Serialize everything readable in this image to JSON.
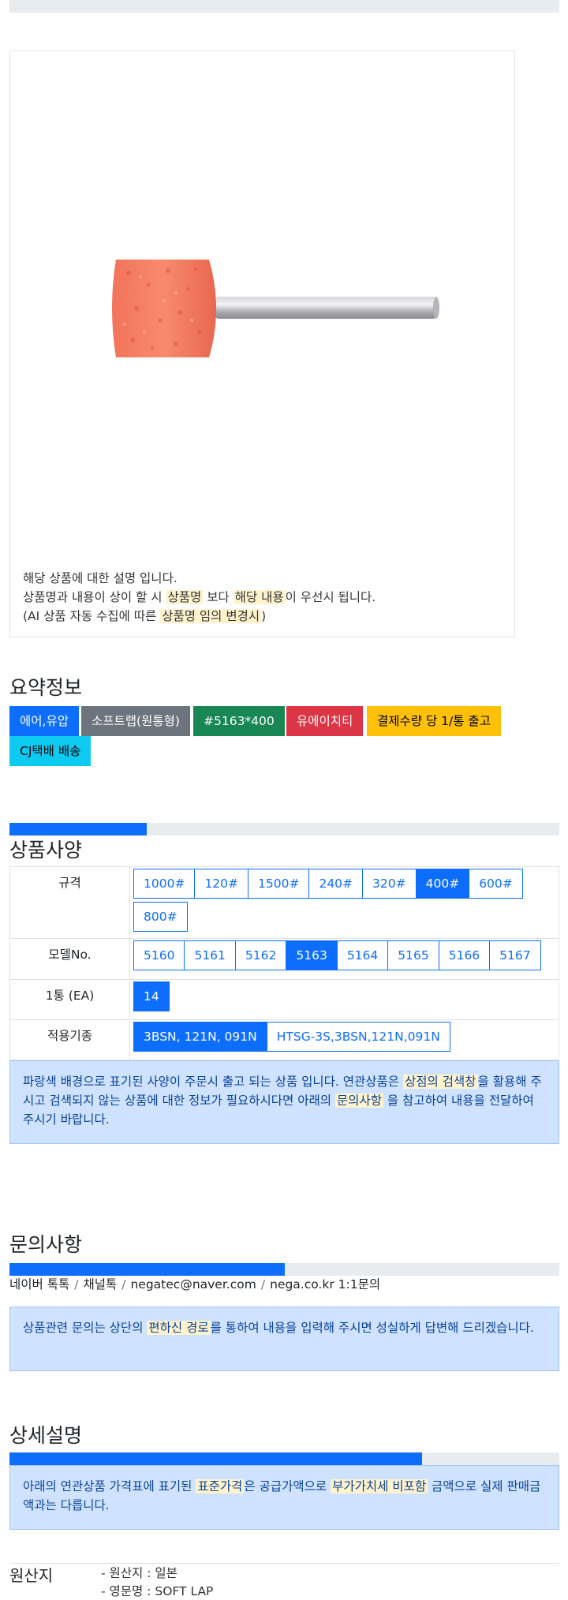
{
  "description": {
    "line1": "해당 상품에 대한 설명 입니다.",
    "line2_a": "상품명과 내용이 상이 할 시 ",
    "line2_hl1": "상품명",
    "line2_b": " 보다 ",
    "line2_hl2": "해당 내용",
    "line2_c": "이 우선시 됩니다.",
    "line3_a": "(AI 상품 자동 수집에 따른 ",
    "line3_hl": "상품명 임의 변경시",
    "line3_b": ")"
  },
  "summary": {
    "title": "요약정보",
    "badges": [
      {
        "label": "에어,유압",
        "color": "#0d6efd",
        "text_color": "#ffffff"
      },
      {
        "label": "소프트랩(원통형)",
        "color": "#6c757d",
        "text_color": "#ffffff"
      },
      {
        "label": "#5163*400",
        "color": "#198754",
        "text_color": "#ffffff"
      },
      {
        "label": "유에이치티",
        "color": "#dc3545",
        "text_color": "#ffffff"
      },
      {
        "label": "결제수량 당 1/통 출고",
        "color": "#ffc107",
        "text_color": "#000000"
      },
      {
        "label": "CJ택배 배송",
        "color": "#0dcaf0",
        "text_color": "#000000"
      }
    ]
  },
  "spec": {
    "title": "상품사양",
    "progress": 0.25,
    "rows": [
      {
        "label": "규격",
        "options": [
          "1000#",
          "120#",
          "1500#",
          "240#",
          "320#",
          "400#",
          "600#",
          "800#"
        ],
        "selected": "400#"
      },
      {
        "label": "모델No.",
        "options": [
          "5160",
          "5161",
          "5162",
          "5163",
          "5164",
          "5165",
          "5166",
          "5167"
        ],
        "selected": "5163"
      },
      {
        "label": "1통 (EA)",
        "options": [
          "14"
        ],
        "selected": "14"
      },
      {
        "label": "적용기종",
        "options": [
          "3BSN, 121N, 091N",
          "HTSG-3S,3BSN,121N,091N"
        ],
        "selected": "3BSN, 121N, 091N"
      }
    ],
    "notice_a": "파랑색 배경으로 표기된 사양이 주문시 출고 되는 상품 입니다. 연관상품은 ",
    "notice_hl1": "상점의 검색창",
    "notice_b": "을 활용해 주시고 검색되지 않는 상품에 대한 정보가 필요하시다면 아래의 ",
    "notice_hl2": "문의사항",
    "notice_c": " 을 참고하여 내용을 전달하여 주시기 바랍니다."
  },
  "inquiry": {
    "title": "문의사항",
    "progress": 0.5,
    "channels": [
      "네이버 톡톡",
      "채널톡",
      "negatec@naver.com",
      "nega.co.kr 1:1문의"
    ],
    "separator": "/",
    "notice_a": "상품관련 문의는 상단의 ",
    "notice_hl": "편하신 경로",
    "notice_b": "를 통하여 내용을 입력해 주시면 성실하게 답변해 드리겠습니다."
  },
  "detail": {
    "title": "상세설명",
    "progress": 0.75,
    "notice_a": "아래의 연관상품 가격표에 표기된 ",
    "notice_hl1": "표준가격",
    "notice_b": "은 공급가액으로 ",
    "notice_hl2": "부가가치세 비포함",
    "notice_c": " 금액으로 실제 판매금액과는 다릅니다."
  },
  "origin": {
    "title": "원산지",
    "items": [
      "- 원산지 : 일본",
      "- 영문명 : SOFT LAP"
    ]
  },
  "colors": {
    "primary": "#0d6efd",
    "highlight": "#fff3cd",
    "alert_bg": "#cfe2ff"
  }
}
